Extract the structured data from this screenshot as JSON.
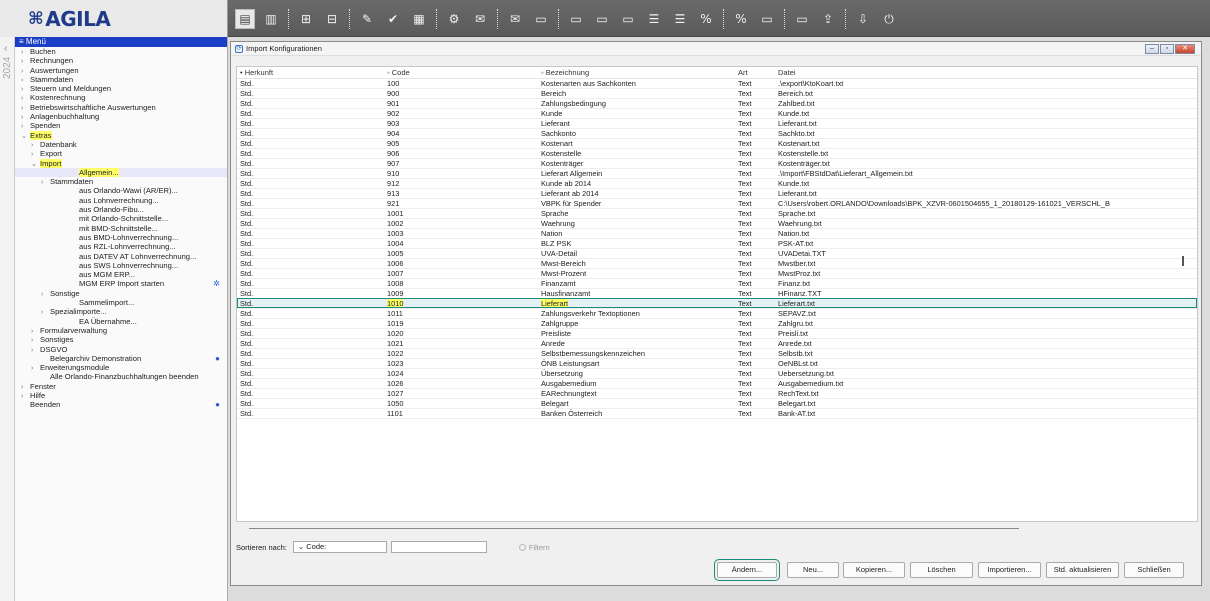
{
  "app": {
    "logo": "AGILA",
    "logo_mark": "⌘",
    "year": "2024"
  },
  "toolbar": {
    "icons": [
      "journal-icon",
      "journal2-icon",
      "account-icon",
      "account2-icon",
      "booking-icon",
      "booking-check-icon",
      "calc-icon",
      "tools-icon",
      "voucher-icon",
      "voucher2-icon",
      "doc-icon",
      "doc2-icon",
      "doc3-icon",
      "doc4-icon",
      "stack-icon",
      "stack2-icon",
      "percent-uva-icon",
      "percent-zm-icon",
      "uva-doc-icon",
      "doc-check-icon",
      "export-icon",
      "import-icon",
      "power-icon"
    ]
  },
  "sidebar": {
    "header": "Menü",
    "items": [
      {
        "label": "Buchen",
        "level": 0,
        "caret": "›"
      },
      {
        "label": "Rechnungen",
        "level": 0,
        "caret": "›"
      },
      {
        "label": "Auswertungen",
        "level": 0,
        "caret": "›"
      },
      {
        "label": "Stammdaten",
        "level": 0,
        "caret": "›"
      },
      {
        "label": "Steuern und Meldungen",
        "level": 0,
        "caret": "›"
      },
      {
        "label": "Kostenrechnung",
        "level": 0,
        "caret": "›"
      },
      {
        "label": "Betriebswirtschaftliche Auswertungen",
        "level": 0,
        "caret": "›"
      },
      {
        "label": "Anlagenbuchhaltung",
        "level": 0,
        "caret": "›"
      },
      {
        "label": "Spenden",
        "level": 0,
        "caret": "›"
      },
      {
        "label": "Extras",
        "level": 0,
        "caret": "⌄",
        "hl": true
      },
      {
        "label": "Datenbank",
        "level": 1,
        "caret": "›"
      },
      {
        "label": "Export",
        "level": 1,
        "caret": "›"
      },
      {
        "label": "Import",
        "level": 1,
        "caret": "⌄",
        "hl": true
      },
      {
        "label": "Allgemein...",
        "level": 3,
        "caret": "",
        "hl": true,
        "sel": true
      },
      {
        "label": "Stammdaten",
        "level": 2,
        "caret": "›"
      },
      {
        "label": "aus Orlando-Wawi (AR/ER)...",
        "level": 3,
        "caret": ""
      },
      {
        "label": "aus Lohnverrechnung...",
        "level": 3,
        "caret": ""
      },
      {
        "label": "aus Orlando-Fibu...",
        "level": 3,
        "caret": ""
      },
      {
        "label": "mit Orlando-Schnittstelle...",
        "level": 3,
        "caret": ""
      },
      {
        "label": "mit BMD-Schnittstelle...",
        "level": 3,
        "caret": ""
      },
      {
        "label": "aus BMD-Lohnverrechnung...",
        "level": 3,
        "caret": ""
      },
      {
        "label": "aus RZL-Lohnverrechnung...",
        "level": 3,
        "caret": ""
      },
      {
        "label": "aus DATEV AT Lohnverrechnung...",
        "level": 3,
        "caret": ""
      },
      {
        "label": "aus SWS Lohnverrechnung...",
        "level": 3,
        "caret": ""
      },
      {
        "label": "aus MGM ERP...",
        "level": 3,
        "caret": ""
      },
      {
        "label": "MGM ERP Import starten",
        "level": 3,
        "caret": "",
        "dot": "✲"
      },
      {
        "label": "Sonstige",
        "level": 2,
        "caret": "›"
      },
      {
        "label": "Sammelimport...",
        "level": 3,
        "caret": ""
      },
      {
        "label": "Spezialimporte...",
        "level": 2,
        "caret": "›"
      },
      {
        "label": "EA Übernahme...",
        "level": 3,
        "caret": ""
      },
      {
        "label": "Formularverwaltung",
        "level": 1,
        "caret": "›"
      },
      {
        "label": "Sonstiges",
        "level": 1,
        "caret": "›"
      },
      {
        "label": "DSGVO",
        "level": 1,
        "caret": "›"
      },
      {
        "label": "Belegarchiv Demonstration",
        "level": 2,
        "caret": "",
        "dot": "●"
      },
      {
        "label": "Erweiterungsmodule",
        "level": 1,
        "caret": "›"
      },
      {
        "label": "Alle Orlando-Finanzbuchhaltungen beenden",
        "level": 2,
        "caret": ""
      },
      {
        "label": "Fenster",
        "level": 0,
        "caret": "›"
      },
      {
        "label": "Hilfe",
        "level": 0,
        "caret": "›"
      },
      {
        "label": "Beenden",
        "level": 0,
        "caret": "",
        "dot": "●"
      }
    ]
  },
  "window": {
    "title": "Import Konfigurationen",
    "controls": [
      "–",
      "▫",
      "✕"
    ]
  },
  "table": {
    "columns": [
      "• Herkunft",
      "◦ Code",
      "◦ Bezeichnung",
      "Art",
      "Datei"
    ],
    "rows": [
      [
        "Std.",
        "100",
        "Kostenarten aus Sachkonten",
        "Text",
        ".\\export\\KtoKoart.txt"
      ],
      [
        "Std.",
        "900",
        "Bereich",
        "Text",
        "Bereich.txt"
      ],
      [
        "Std.",
        "901",
        "Zahlungsbedingung",
        "Text",
        "Zahlbed.txt"
      ],
      [
        "Std.",
        "902",
        "Kunde",
        "Text",
        "Kunde.txt"
      ],
      [
        "Std.",
        "903",
        "Lieferant",
        "Text",
        "Lieferant.txt"
      ],
      [
        "Std.",
        "904",
        "Sachkonto",
        "Text",
        "Sachkto.txt"
      ],
      [
        "Std.",
        "905",
        "Kostenart",
        "Text",
        "Kostenart.txt"
      ],
      [
        "Std.",
        "906",
        "Kostenstelle",
        "Text",
        "Kostenstelle.txt"
      ],
      [
        "Std.",
        "907",
        "Kostenträger",
        "Text",
        "Kostenträger.txt"
      ],
      [
        "Std.",
        "910",
        "Lieferart Allgemein",
        "Text",
        ".\\Import\\FBStdDat\\Lieferart_Allgemein.txt"
      ],
      [
        "Std.",
        "912",
        "Kunde ab 2014",
        "Text",
        "Kunde.txt"
      ],
      [
        "Std.",
        "913",
        "Lieferant ab 2014",
        "Text",
        "Lieferant.txt"
      ],
      [
        "Std.",
        "921",
        "VBPK für Spender",
        "Text",
        "C:\\Users\\robert.ORLANDO\\Downloads\\BPK_XZVR-0601504655_1_20180129-161021_VERSCHL_B"
      ],
      [
        "Std.",
        "1001",
        "Sprache",
        "Text",
        "Sprache.txt"
      ],
      [
        "Std.",
        "1002",
        "Waehrung",
        "Text",
        "Waehrung.txt"
      ],
      [
        "Std.",
        "1003",
        "Nation",
        "Text",
        "Nation.txt"
      ],
      [
        "Std.",
        "1004",
        "BLZ PSK",
        "Text",
        "PSK-AT.txt"
      ],
      [
        "Std.",
        "1005",
        "UVA-Detail",
        "Text",
        "UVADetai.TXT"
      ],
      [
        "Std.",
        "1006",
        "Mwst-Bereich",
        "Text",
        "Mwstber.txt"
      ],
      [
        "Std.",
        "1007",
        "Mwst-Prozent",
        "Text",
        "MwstProz.txt"
      ],
      [
        "Std.",
        "1008",
        "Finanzamt",
        "Text",
        "Finanz.txt"
      ],
      [
        "Std.",
        "1009",
        "Hausfinanzamt",
        "Text",
        "HFinanz.TXT"
      ],
      [
        "Std.",
        "1010",
        "Lieferart",
        "Text",
        "Lieferart.txt"
      ],
      [
        "Std.",
        "1011",
        "Zahlungsverkehr Textoptionen",
        "Text",
        "SEPAVZ.txt"
      ],
      [
        "Std.",
        "1019",
        "Zahlgruppe",
        "Text",
        "Zahlgru.txt"
      ],
      [
        "Std.",
        "1020",
        "Preisliste",
        "Text",
        "Preisli.txt"
      ],
      [
        "Std.",
        "1021",
        "Anrede",
        "Text",
        "Anrede.txt"
      ],
      [
        "Std.",
        "1022",
        "Selbstbemessungskennzeichen",
        "Text",
        "Selbstb.txt"
      ],
      [
        "Std.",
        "1023",
        "ÖNB Leistungsart",
        "Text",
        "OeNBLst.txt"
      ],
      [
        "Std.",
        "1024",
        "Übersetzung",
        "Text",
        "Uebersetzung.txt"
      ],
      [
        "Std.",
        "1026",
        "Ausgabemedium",
        "Text",
        "Ausgabemedium.txt"
      ],
      [
        "Std.",
        "1027",
        "EARechnungtext",
        "Text",
        "RechText.txt"
      ],
      [
        "Std.",
        "1050",
        "Belegart",
        "Text",
        "Belegart.txt"
      ],
      [
        "Std.",
        "1101",
        "Banken Österreich",
        "Text",
        "Bank-AT.txt"
      ]
    ],
    "selected_index": 22
  },
  "sort": {
    "label": "Sortieren nach:",
    "selected": "Code:",
    "input_value": "",
    "filter_label": "Filtern"
  },
  "buttons": {
    "aendern": "Ändern...",
    "neu": "Neu...",
    "kopieren": "Kopieren...",
    "loeschen": "Löschen",
    "importieren": "Importieren...",
    "std_aktualisieren": "Std. aktualisieren",
    "schliessen": "Schließen"
  }
}
